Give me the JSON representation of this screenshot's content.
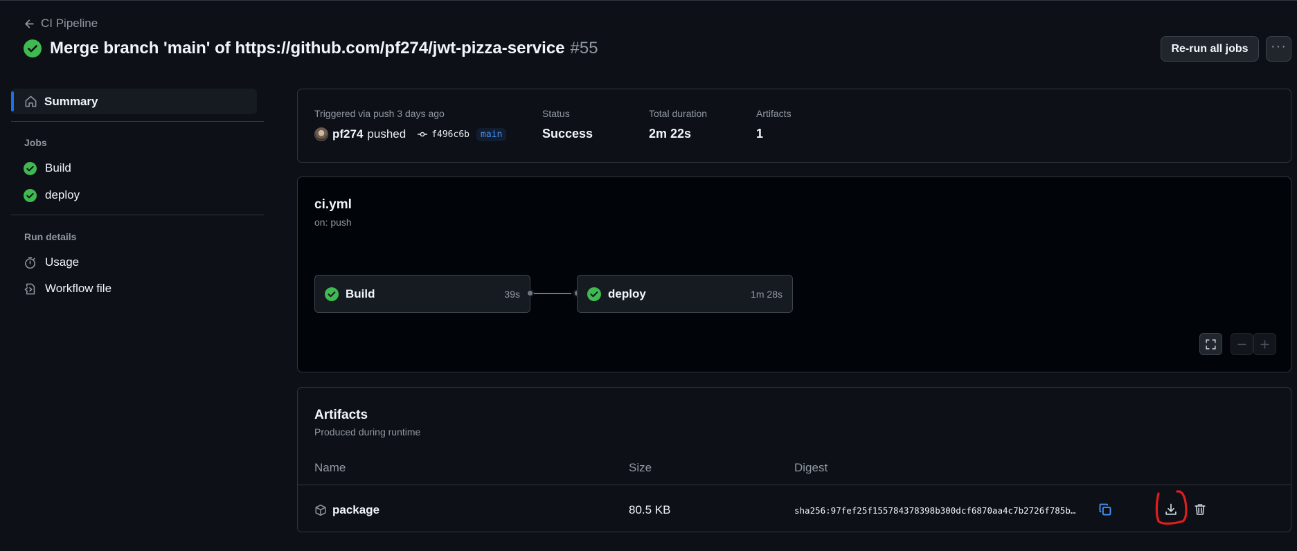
{
  "colors": {
    "success": "#3fb950",
    "accent": "#1f6feb",
    "link": "#4493f8",
    "annotation": "#e11d1d"
  },
  "header": {
    "back_label": "CI Pipeline",
    "title": "Merge branch 'main' of https://github.com/pf274/jwt-pizza-service",
    "run_number": "#55",
    "rerun_label": "Re-run all jobs"
  },
  "sidebar": {
    "summary_label": "Summary",
    "jobs_heading": "Jobs",
    "jobs": [
      "Build",
      "deploy"
    ],
    "run_details_heading": "Run details",
    "usage_label": "Usage",
    "workflow_file_label": "Workflow file"
  },
  "summary": {
    "triggered_label": "Triggered via push 3 days ago",
    "actor": "pf274",
    "action": "pushed",
    "commit": "f496c6b",
    "branch": "main",
    "status_label": "Status",
    "status_value": "Success",
    "duration_label": "Total duration",
    "duration_value": "2m 22s",
    "artifacts_label": "Artifacts",
    "artifacts_value": "1"
  },
  "workflow": {
    "file": "ci.yml",
    "trigger": "on: push",
    "jobs": [
      {
        "name": "Build",
        "duration": "39s"
      },
      {
        "name": "deploy",
        "duration": "1m 28s"
      }
    ]
  },
  "artifacts": {
    "title": "Artifacts",
    "subtitle": "Produced during runtime",
    "columns": [
      "Name",
      "Size",
      "Digest"
    ],
    "rows": [
      {
        "name": "package",
        "size": "80.5 KB",
        "digest": "sha256:97fef25f155784378398b300dcf6870aa4c7b2726f785b…"
      }
    ]
  }
}
